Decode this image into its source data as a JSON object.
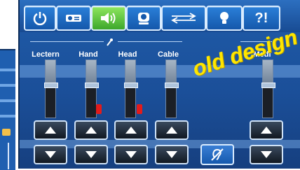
{
  "window": {
    "toolbar": {
      "buttons": [
        {
          "name": "power",
          "active": false
        },
        {
          "name": "projector",
          "active": false
        },
        {
          "name": "audio",
          "active": true
        },
        {
          "name": "camera",
          "active": false
        },
        {
          "name": "switcher",
          "active": false
        },
        {
          "name": "lighting",
          "active": false
        },
        {
          "name": "help",
          "label": "?!",
          "active": false
        }
      ]
    },
    "channels": [
      {
        "label": "Lectern",
        "mute_indicator": false
      },
      {
        "label": "Hand",
        "mute_indicator": true
      },
      {
        "label": "Head",
        "mute_indicator": true
      },
      {
        "label": "Cable",
        "mute_indicator": false
      },
      {
        "label": "Medi",
        "mute_indicator": false
      }
    ],
    "hearing_button": {
      "icon": "hearing-loop-icon"
    },
    "watermark": "old design",
    "colors": {
      "panel": "#1b4f99",
      "active_tab": "#48b231",
      "mute": "#e21b1b",
      "watermark": "#ffe600"
    }
  }
}
